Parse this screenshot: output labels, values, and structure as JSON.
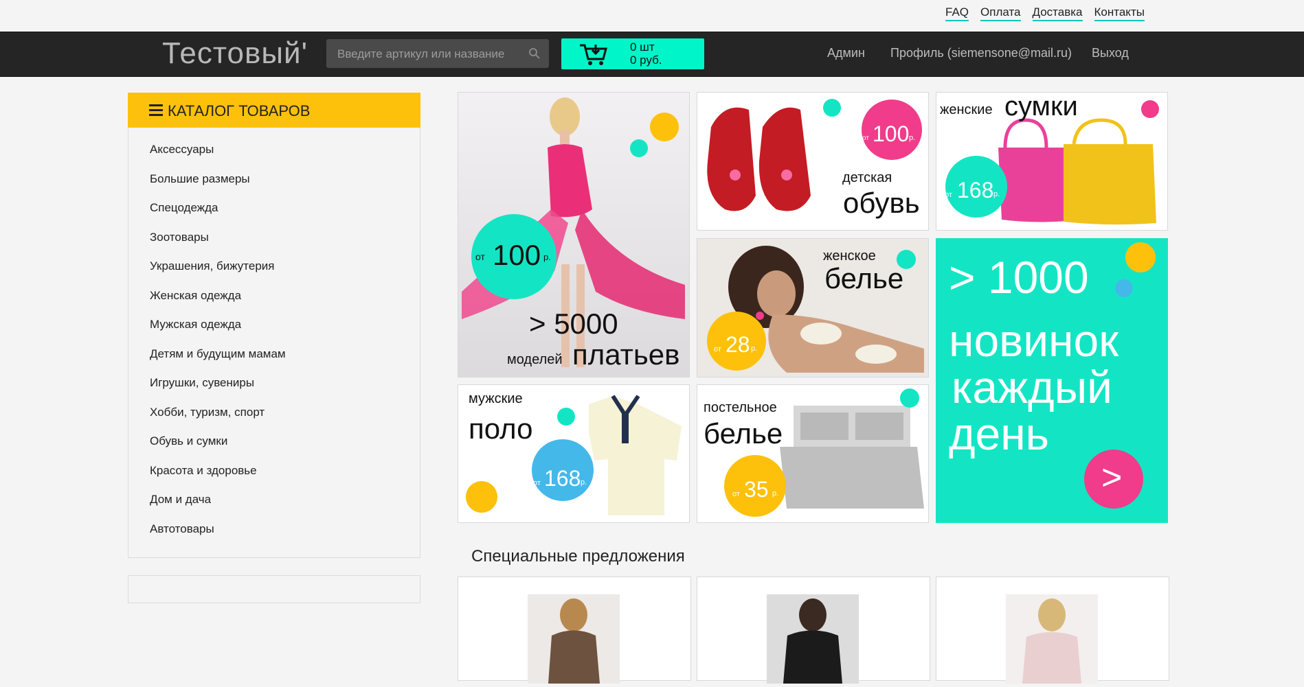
{
  "top_links": [
    "FAQ",
    "Оплата",
    "Доставка",
    "Контакты"
  ],
  "header": {
    "logo": "Тестовый'",
    "search_placeholder": "Введите артикул или название",
    "cart_count": "0 шт",
    "cart_sum": "0 руб.",
    "nav": [
      "Админ",
      "Профиль (siemensone@mail.ru)",
      "Выход"
    ]
  },
  "catalog": {
    "title": "КАТАЛОГ ТОВАРОВ",
    "items": [
      "Аксессуары",
      "Большие размеры",
      "Спецодежда",
      "Зоотовары",
      "Украшения, бижутерия",
      "Женская одежда",
      "Мужская одежда",
      "Детям и будущим мамам",
      "Игрушки, сувениры",
      "Хобби, туризм, спорт",
      "Обувь и сумки",
      "Красота и здоровье",
      "Дом и дача",
      "Автотовары"
    ]
  },
  "banners": {
    "dresses": {
      "from": "от",
      "price": "100",
      "cur": "р.",
      "count": "> 5000",
      "line2a": "моделей",
      "line2b": "платьев"
    },
    "kids_shoes": {
      "from": "от",
      "price": "100",
      "cur": "р.",
      "l1": "детская",
      "l2": "обувь"
    },
    "bags": {
      "l1": "женские",
      "l2": "сумки",
      "from": "от",
      "price": "168",
      "cur": "р."
    },
    "lingerie": {
      "l1": "женское",
      "l2": "белье",
      "from": "от",
      "price": "28",
      "cur": "р."
    },
    "novelties": {
      "l1": "> 1000",
      "l2": "новинок",
      "l3": "каждый",
      "l4": "день",
      "arrow": ">"
    },
    "polo": {
      "l1": "мужские",
      "l2": "поло",
      "from": "от",
      "price": "168",
      "cur": "р."
    },
    "bedding": {
      "l1": "постельное",
      "l2": "белье",
      "from": "от",
      "price": "35",
      "cur": "р."
    }
  },
  "specials": {
    "title": "Специальные предложения"
  },
  "colors": {
    "accent": "#fdc10b",
    "cart": "#00f5c8",
    "teal": "#13e5c4",
    "pink": "#f03c8a",
    "blue": "#45b8ea"
  }
}
